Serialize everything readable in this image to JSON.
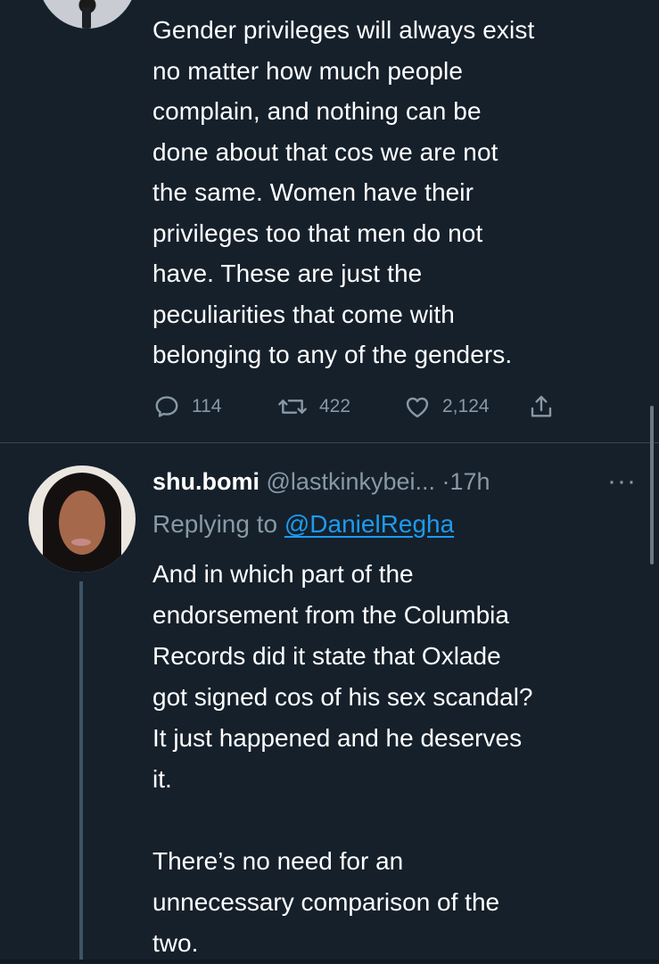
{
  "main_tweet": {
    "text": "Gender privileges will always exist\nno matter how much people\ncomplain, and nothing can be\ndone about that cos we are not\nthe same. Women have their\nprivileges too that men do not\nhave. These are just the\npeculiarities that come with\nbelonging to any of the genders.",
    "actions": {
      "reply_count": "114",
      "retweet_count": "422",
      "like_count": "2,124"
    },
    "icons": [
      "comment-icon",
      "retweet-icon",
      "like-icon",
      "share-icon"
    ]
  },
  "reply": {
    "display_name": "shu.bomi",
    "handle": "@lastkinkybei...",
    "time": "·17h",
    "more": "···",
    "replying_to_prefix": "Replying to",
    "replying_to_handle": "@DanielRegha",
    "text": "And in which part of the\nendorsement from the Columbia\nRecords did it state that Oxlade\ngot signed cos of his sex scandal?\nIt just happened and he deserves\nit.\n\nThere’s no need for an\nunnecessary comparison of the\ntwo."
  },
  "colors": {
    "background": "#15202b",
    "text": "#ffffff",
    "secondary_text": "#8899a6",
    "link": "#1d9bf0",
    "divider": "#38444d",
    "thread_line": "#3d5466"
  }
}
